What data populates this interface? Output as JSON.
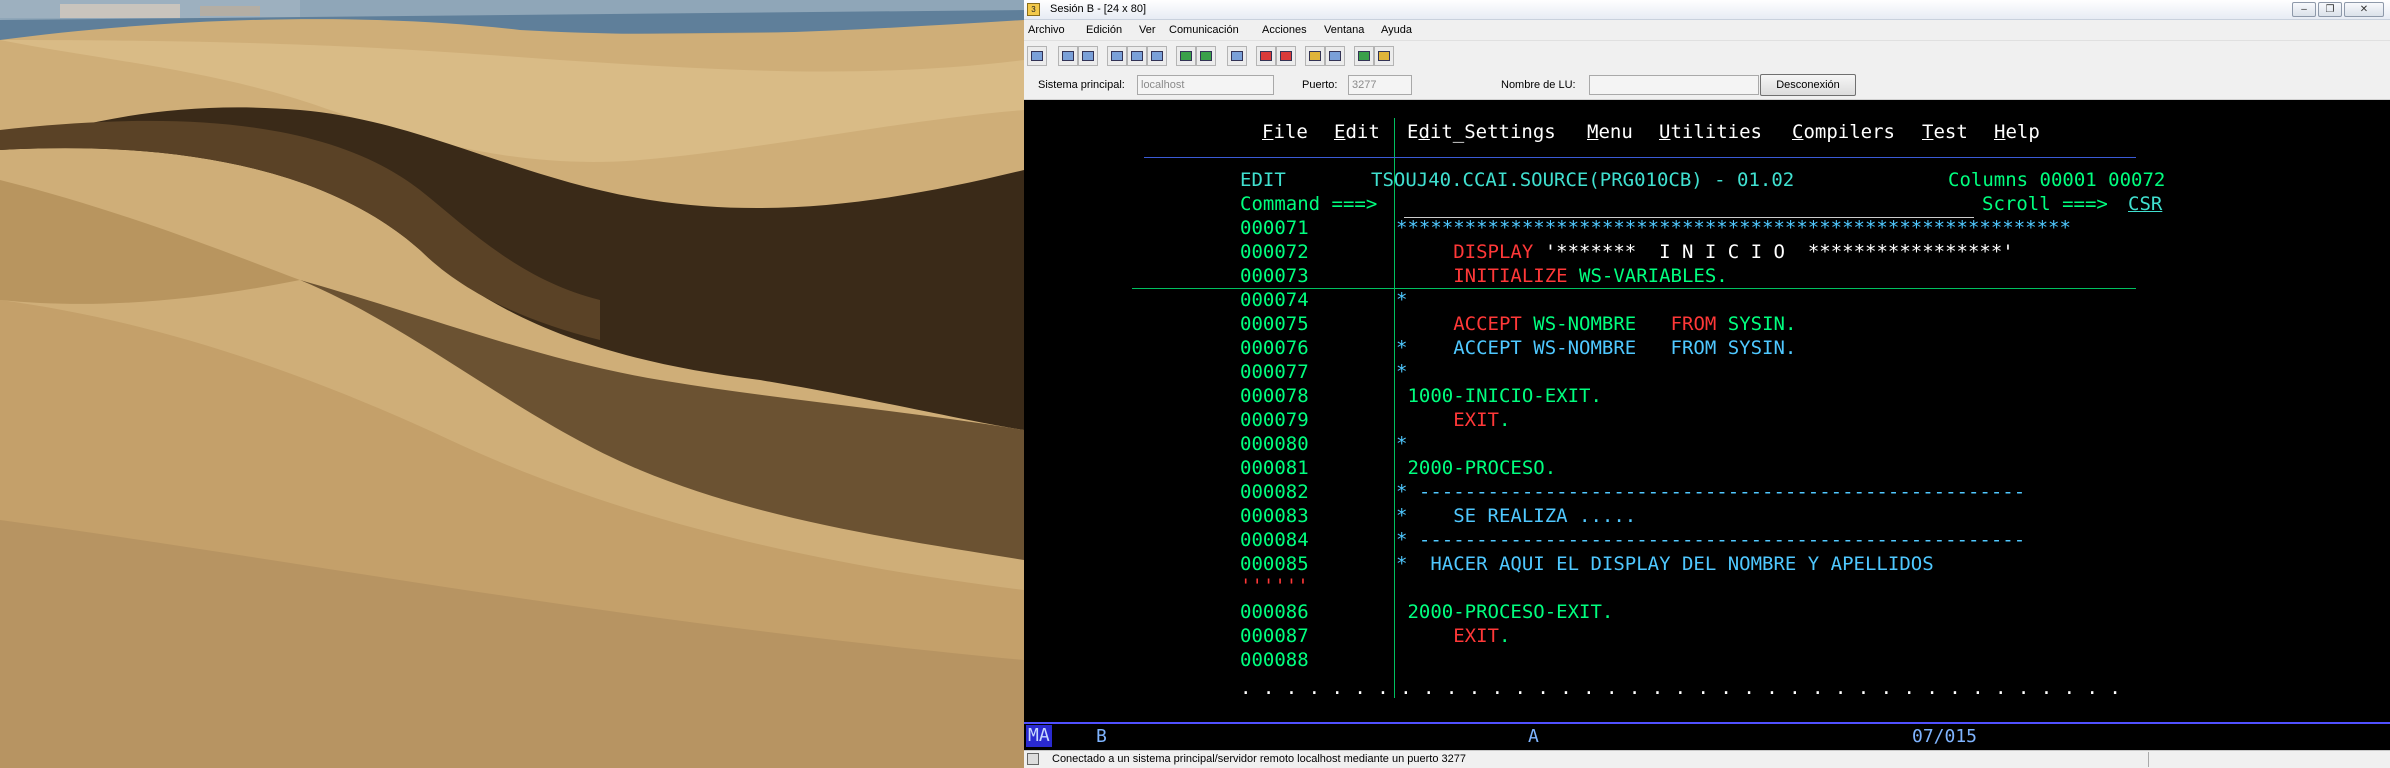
{
  "window": {
    "title": "Sesión B - [24 x 80]",
    "controls": {
      "minimize": "‒",
      "maximize": "❐",
      "close": "✕"
    }
  },
  "menu": [
    "Archivo",
    "Edición",
    "Ver",
    "Comunicación",
    "Acciones",
    "Ventana",
    "Ayuda"
  ],
  "connection": {
    "host_label": "Sistema principal:",
    "host_value": "localhost",
    "port_label": "Puerto:",
    "port_value": "3277",
    "lu_label": "Nombre de LU:",
    "lu_value": "",
    "disconnect": "Desconexión"
  },
  "ispf": {
    "menu": [
      "File",
      "Edit",
      "Edit_Settings",
      "Menu",
      "Utilities",
      "Compilers",
      "Test",
      "Help"
    ],
    "mode": "EDIT",
    "dataset": "TSOUJ40.CCAI.SOURCE(PRG010CB) - 01.02",
    "columns": "Columns 00001 00072",
    "command_prompt": "Command ===>",
    "scroll_prompt": "Scroll ===>",
    "scroll_value": "CSR",
    "lines": [
      {
        "num": "000071",
        "text": "***********************************************************"
      },
      {
        "num": "000072",
        "kw": "     DISPLAY ",
        "rest": "'*******  I N I C I O  *****************'"
      },
      {
        "num": "000073",
        "kw": "     INITIALIZE ",
        "rest": "WS-VARIABLES."
      },
      {
        "num": "000074",
        "text": "*"
      },
      {
        "num": "000075",
        "kw": "     ACCEPT ",
        "rest": "WS-NOMBRE   ",
        "kw2": "FROM ",
        "rest2": "SYSIN."
      },
      {
        "num": "000076",
        "text": "*    ACCEPT WS-NOMBRE   FROM SYSIN."
      },
      {
        "num": "000077",
        "text": "*"
      },
      {
        "num": "000078",
        "text": " 1000-INICIO-EXIT."
      },
      {
        "num": "000079",
        "kw": "     EXIT",
        "rest": "."
      },
      {
        "num": "000080",
        "text": "*"
      },
      {
        "num": "000081",
        "text": " 2000-PROCESO."
      },
      {
        "num": "000082",
        "text": "* -----------------------------------------------------"
      },
      {
        "num": "000083",
        "text": "*    SE REALIZA ....."
      },
      {
        "num": "000084",
        "text": "* -----------------------------------------------------"
      },
      {
        "num": "000085",
        "text": "*  HACER AQUI EL DISPLAY DEL NOMBRE Y APELLIDOS"
      },
      {
        "num": "''''''",
        "text": ""
      },
      {
        "num": "000086",
        "text": " 2000-PROCESO-EXIT."
      },
      {
        "num": "000087",
        "kw": "     EXIT",
        "rest": "."
      },
      {
        "num": "000088",
        "text": ""
      }
    ],
    "dots": ". . . . . . . . . . . . . . . . . . . . . . . . . . . . . . . . . . . . . . ."
  },
  "oia": {
    "ma": "MA",
    "b": "B",
    "a": "A",
    "cursor": "07/015"
  },
  "status": {
    "message": "Conectado a un sistema principal/servidor remoto localhost mediante un puerto 3277"
  }
}
